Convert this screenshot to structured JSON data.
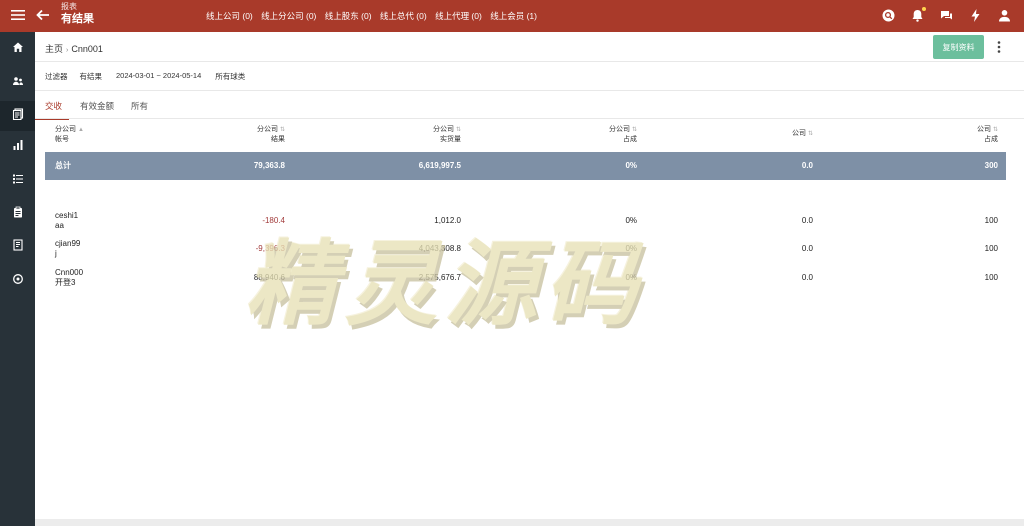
{
  "header": {
    "subtitle": "报表",
    "title": "有结果",
    "stats": [
      "线上公司 (0)",
      "线上分公司 (0)",
      "线上股东 (0)",
      "线上总代 (0)",
      "线上代理 (0)",
      "线上会员 (1)"
    ],
    "brand_color": "#a93a2a"
  },
  "breadcrumb": {
    "home": "主页",
    "current": "Cnn001"
  },
  "actions": {
    "copy_label": "复制资料"
  },
  "filters": {
    "label": "过滤器",
    "result": "有结果",
    "date_range": "2024-03-01 ~ 2024-05-14",
    "game_type": "所有球类"
  },
  "tabs": [
    {
      "label": "交收",
      "active": true
    },
    {
      "label": "有效金额",
      "active": false
    },
    {
      "label": "所有",
      "active": false
    }
  ],
  "table": {
    "headers": [
      {
        "line1": "分公司",
        "line2": "帐号"
      },
      {
        "line1": "分公司",
        "line2": "结果"
      },
      {
        "line1": "分公司",
        "line2": "实货量"
      },
      {
        "line1": "分公司",
        "line2": "占成"
      },
      {
        "line1": "公司",
        "line2": ""
      },
      {
        "line1": "公司",
        "line2": "占成"
      }
    ],
    "total": {
      "label": "总计",
      "result": "79,363.8",
      "volume": "6,619,997.5",
      "share": "0%",
      "company": "0.0",
      "company_share": "300"
    },
    "rows": [
      {
        "account1": "ceshi1",
        "account2": "aa",
        "result": "-180.4",
        "volume": "1,012.0",
        "share": "0%",
        "company": "0.0",
        "company_share": "100"
      },
      {
        "account1": "cjian99",
        "account2": "j",
        "result": "-9,396.3",
        "volume": "4,043,308.8",
        "share": "0%",
        "company": "0.0",
        "company_share": "100"
      },
      {
        "account1": "Cnn000",
        "account2": "开登3",
        "result": "88,940.6",
        "volume": "2,575,676.7",
        "share": "0%",
        "company": "0.0",
        "company_share": "100"
      }
    ]
  },
  "watermark": "精灵源码"
}
